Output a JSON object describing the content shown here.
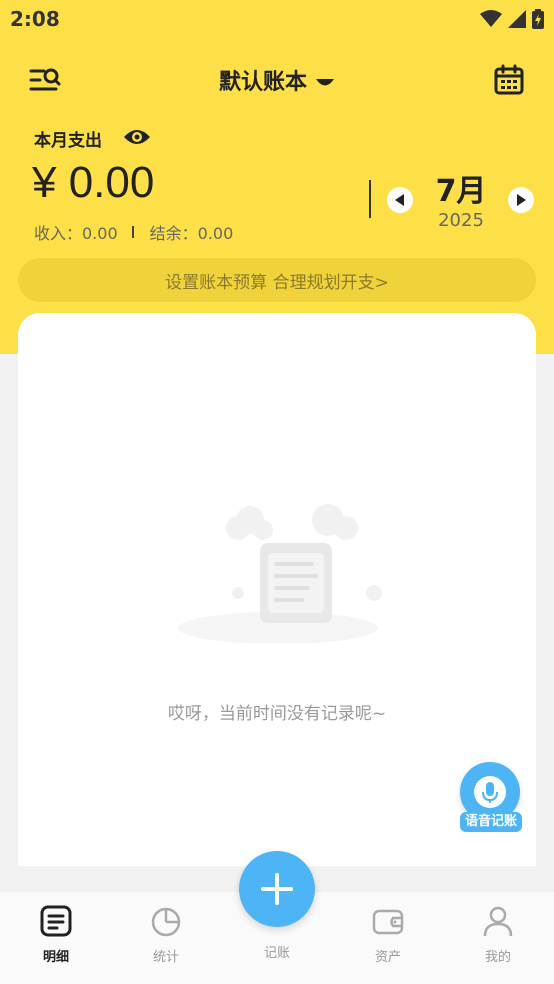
{
  "status_bar": {
    "time": "2:08"
  },
  "header": {
    "book_name": "默认账本"
  },
  "summary": {
    "expense_label": "本月支出",
    "amount": "¥ 0.00",
    "income_text": "收入：0.00",
    "balance_text": "结余：0.00"
  },
  "period": {
    "month": "7月",
    "year": "2025"
  },
  "budget_banner": "设置账本预算 合理规划开支>",
  "empty_state": {
    "message": "哎呀，当前时间没有记录呢~"
  },
  "voice_button": {
    "label": "语音记账"
  },
  "tabbar": {
    "tabs": [
      {
        "label": "明细",
        "icon": "list-icon",
        "active": true
      },
      {
        "label": "统计",
        "icon": "pie-chart-icon",
        "active": false
      },
      {
        "label": "记账",
        "icon": "plus-icon",
        "active": false
      },
      {
        "label": "资产",
        "icon": "wallet-icon",
        "active": false
      },
      {
        "label": "我的",
        "icon": "user-icon",
        "active": false
      }
    ]
  },
  "colors": {
    "primary_yellow": "#fde047",
    "accent_blue": "#4db5f5"
  }
}
